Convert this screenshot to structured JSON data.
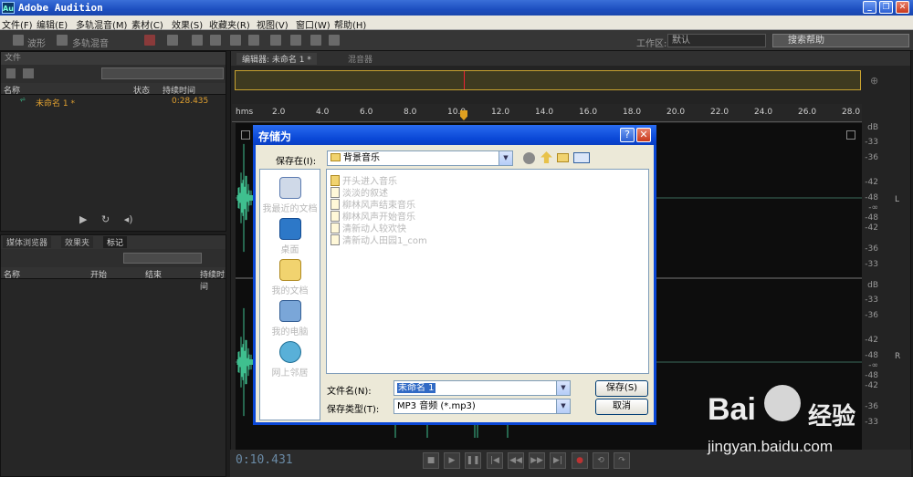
{
  "app": {
    "title": "Adobe Audition"
  },
  "menu": [
    "文件(F)",
    "编辑(E)",
    "多轨混音(M)",
    "素材(C)",
    "效果(S)",
    "收藏夹(R)",
    "视图(V)",
    "窗口(W)",
    "帮助(H)"
  ],
  "toolbar": {
    "waveform": "波形",
    "multitrack": "多轨混音",
    "workspace_label": "工作区:",
    "workspace_value": "默认",
    "search_placeholder": "搜索帮助"
  },
  "files_panel": {
    "tab": "文件",
    "headers": {
      "name": "名称",
      "status": "状态",
      "duration": "持续时间"
    },
    "rows": [
      {
        "name": "未命名 1 *",
        "duration": "0:28.435"
      }
    ]
  },
  "lower_panel": {
    "tabs": [
      "媒体浏览器",
      "效果夹",
      "标记"
    ],
    "headers": {
      "name": "名称",
      "start": "开始",
      "end": "结束",
      "duration": "持续时间"
    }
  },
  "editor": {
    "tabs": [
      "编辑器: 未命名 1 *",
      "混音器"
    ],
    "ruler_unit": "hms",
    "ruler_ticks": [
      "2.0",
      "4.0",
      "6.0",
      "8.0",
      "10.0",
      "12.0",
      "14.0",
      "16.0",
      "18.0",
      "20.0",
      "22.0",
      "24.0",
      "26.0",
      "28.0"
    ],
    "db_unit": "dB",
    "db_top": [
      "-33",
      "-36",
      "-42",
      "-48",
      "-∞",
      "-48",
      "-42",
      "-36",
      "-33"
    ],
    "db_bottom": [
      "-33",
      "-36",
      "-42",
      "-48",
      "-∞",
      "-48",
      "-42",
      "-36",
      "-33"
    ],
    "channel_labels": [
      "L",
      "R"
    ],
    "playhead_seconds": 10.4,
    "timecode": "0:10.431",
    "wave_color": "#3fbf8f"
  },
  "dialog": {
    "title": "存储为",
    "help_btn": "?",
    "save_in_label": "保存在(I):",
    "save_in_value": "背景音乐",
    "places": [
      "我最近的文档",
      "桌面",
      "我的文档",
      "我的电脑",
      "网上邻居"
    ],
    "files": [
      {
        "name": "开头进入音乐",
        "type": "folder"
      },
      {
        "name": "淡淡的叙述",
        "type": "audio"
      },
      {
        "name": "柳林风声结束音乐",
        "type": "audio"
      },
      {
        "name": "柳林风声开始音乐",
        "type": "audio"
      },
      {
        "name": "清新动人较欢快",
        "type": "audio"
      },
      {
        "name": "清新动人田园1_com",
        "type": "audio"
      }
    ],
    "filename_label": "文件名(N):",
    "filename_value": "未命名 1",
    "filetype_label": "保存类型(T):",
    "filetype_value": "MP3 音频 (*.mp3)",
    "save_btn": "保存(S)",
    "cancel_btn": "取消"
  },
  "watermark": {
    "brand": "Bai",
    "suffix": "经验",
    "url": "jingyan.baidu.com"
  }
}
